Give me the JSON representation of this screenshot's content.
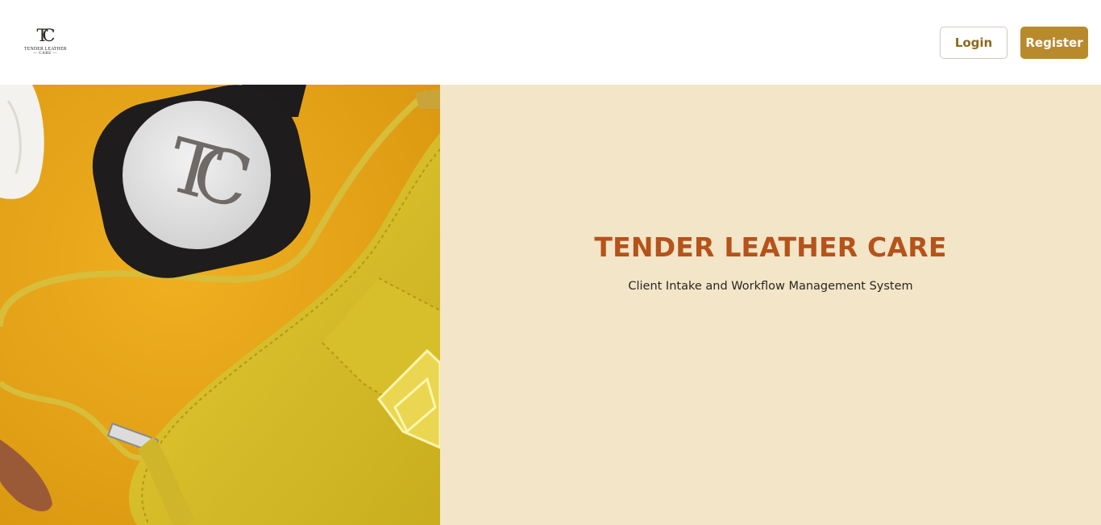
{
  "brand": {
    "logo_mark": "TC",
    "logo_name": "TENDER LEATHER",
    "logo_sub": "— CARE —"
  },
  "nav": {
    "login_label": "Login",
    "register_label": "Register"
  },
  "hero": {
    "title": "TENDER LEATHER CARE",
    "subtitle": "Client Intake and Workflow Management System",
    "image_emblem": "TC"
  },
  "colors": {
    "accent": "#b98a2c",
    "title": "#b5531a",
    "panel_background": "#f3e5c8",
    "image_background": "#e2a219",
    "bag": "#d9bf2b"
  }
}
